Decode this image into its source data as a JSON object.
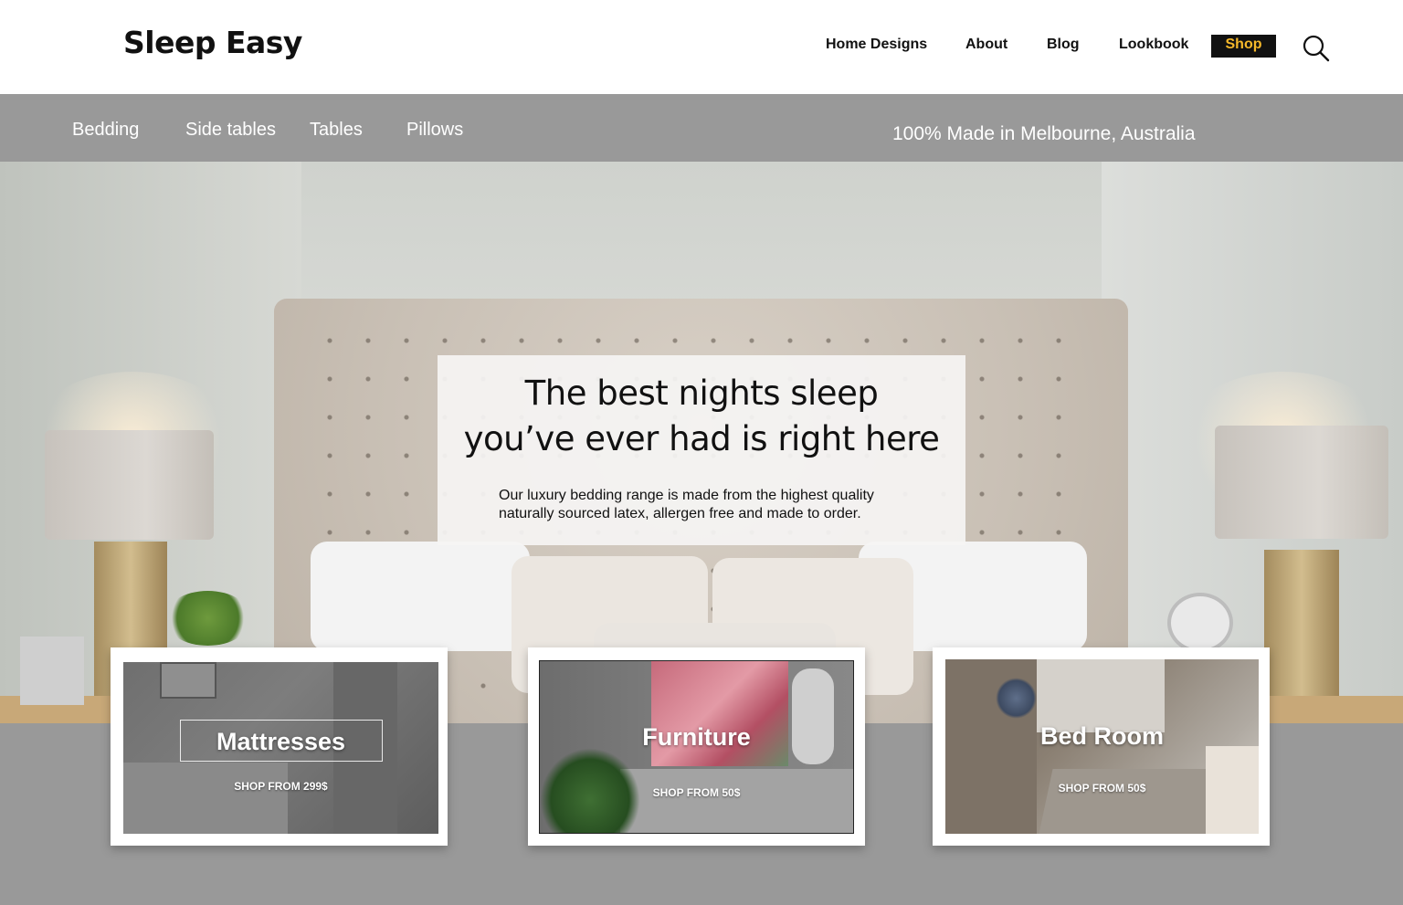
{
  "header": {
    "logo": "Sleep Easy",
    "nav": [
      "Home Designs",
      "About",
      "Blog",
      "Lookbook"
    ],
    "shop_label": "Shop",
    "search_icon": "search-icon"
  },
  "subnav": {
    "items": [
      "Bedding",
      "Side tables",
      "Tables",
      "Pillows"
    ],
    "tagline": "100% Made in Melbourne, Australia"
  },
  "hero": {
    "title_line1": "The best nights sleep",
    "title_line2": "you’ve ever had is right here",
    "desc_line1": "Our luxury bedding range is made from the highest quality",
    "desc_line2": "naturally sourced latex, allergen free and made to order."
  },
  "cards": [
    {
      "title": "Mattresses",
      "subtitle": "SHOP FROM 299$"
    },
    {
      "title": "Furniture",
      "subtitle": "SHOP FROM 50$"
    },
    {
      "title": "Bed Room",
      "subtitle": "SHOP FROM 50$"
    }
  ],
  "colors": {
    "shop_bg": "#111111",
    "shop_text": "#f5b82a",
    "subnav_bg": "#999999",
    "page_bg": "#999999"
  }
}
